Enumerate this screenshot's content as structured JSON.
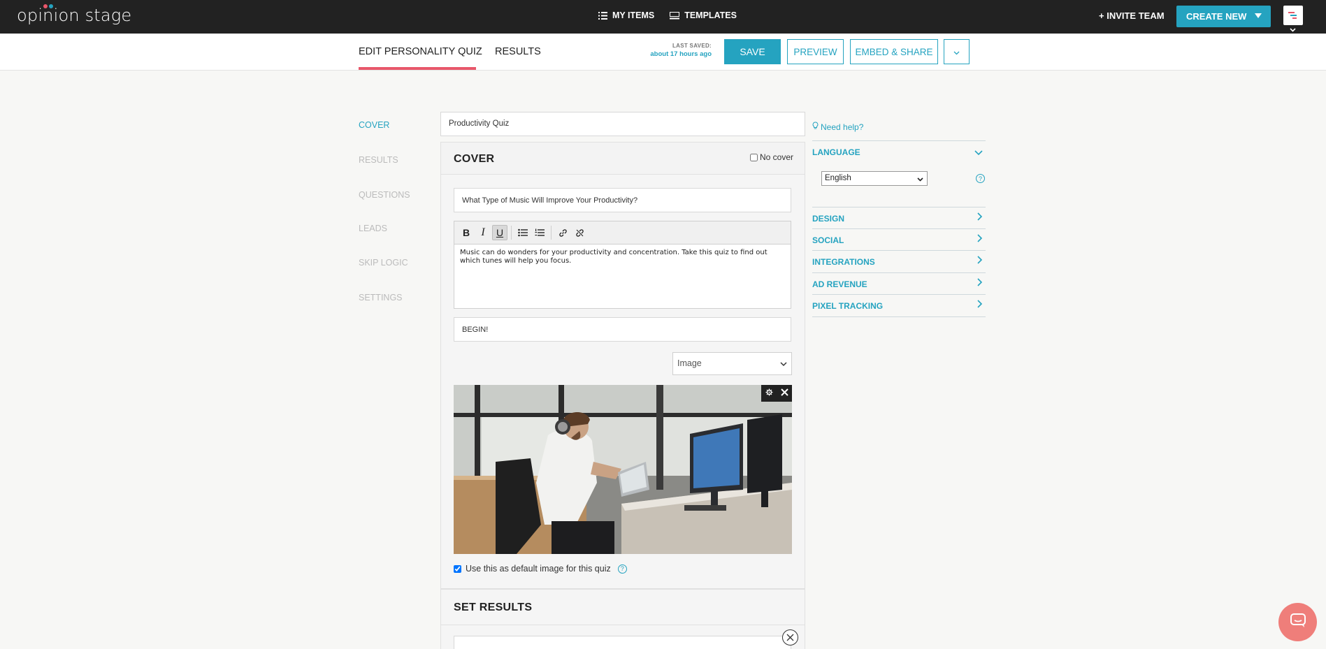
{
  "app": {
    "logo_text": "opinion stage",
    "nav": {
      "my_items": "MY ITEMS",
      "templates": "TEMPLATES"
    },
    "invite_label": "+ INVITE TEAM",
    "create_new_label": "CREATE NEW"
  },
  "subheader": {
    "tabs": [
      {
        "label": "EDIT PERSONALITY QUIZ",
        "active": true
      },
      {
        "label": "RESULTS",
        "active": false
      }
    ],
    "last_saved_label": "LAST SAVED:",
    "last_saved_value": "about 17 hours ago",
    "buttons": {
      "save": "SAVE",
      "preview": "PREVIEW",
      "embed": "EMBED & SHARE"
    }
  },
  "sidebar": {
    "items": [
      {
        "label": "COVER",
        "active": true
      },
      {
        "label": "RESULTS",
        "active": false
      },
      {
        "label": "QUESTIONS",
        "active": false
      },
      {
        "label": "LEADS",
        "active": false
      },
      {
        "label": "SKIP LOGIC",
        "active": false
      },
      {
        "label": "SETTINGS",
        "active": false
      }
    ]
  },
  "main": {
    "quiz_title": "Productivity Quiz",
    "cover": {
      "heading": "COVER",
      "no_cover_label": "No cover",
      "no_cover_checked": false,
      "question": "What Type of Music Will Improve Your Productivity?",
      "description": "Music can do wonders for your productivity and concentration. Take this quiz to find out which tunes will help you focus.",
      "button_text": "BEGIN!",
      "media_type": "Image",
      "default_image_label": "Use this as default image for this quiz",
      "default_image_checked": true
    },
    "set_results_heading": "SET RESULTS"
  },
  "right_panel": {
    "need_help": "Need help?",
    "sections": [
      {
        "label": "LANGUAGE",
        "expanded": true
      },
      {
        "label": "DESIGN",
        "expanded": false
      },
      {
        "label": "SOCIAL",
        "expanded": false
      },
      {
        "label": "INTEGRATIONS",
        "expanded": false
      },
      {
        "label": "AD REVENUE",
        "expanded": false
      },
      {
        "label": "PIXEL TRACKING",
        "expanded": false
      }
    ],
    "language_value": "English"
  },
  "colors": {
    "accent": "#25a3c0",
    "topbar": "#222222",
    "active_tab_underline": "#e8576a",
    "chat_bubble": "#ef7e7a"
  },
  "icons": [
    "list-icon",
    "templates-icon",
    "caret-down-icon",
    "chevron-down-icon",
    "chevron-right-icon",
    "bold-icon",
    "italic-icon",
    "underline-icon",
    "bullet-list-icon",
    "numbered-list-icon",
    "link-icon",
    "unlink-icon",
    "gear-icon",
    "close-icon",
    "help-icon",
    "lightbulb-icon",
    "chat-icon"
  ]
}
